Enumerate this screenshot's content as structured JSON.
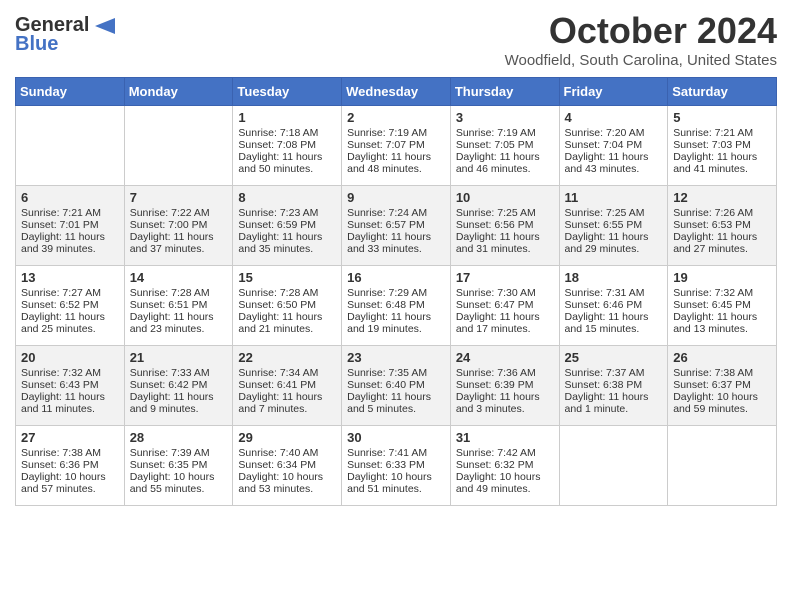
{
  "logo": {
    "line1": "General",
    "line2": "Blue",
    "icon": "▶"
  },
  "title": "October 2024",
  "location": "Woodfield, South Carolina, United States",
  "days_of_week": [
    "Sunday",
    "Monday",
    "Tuesday",
    "Wednesday",
    "Thursday",
    "Friday",
    "Saturday"
  ],
  "weeks": [
    [
      {
        "day": "",
        "content": ""
      },
      {
        "day": "",
        "content": ""
      },
      {
        "day": "1",
        "content": "Sunrise: 7:18 AM\nSunset: 7:08 PM\nDaylight: 11 hours and 50 minutes."
      },
      {
        "day": "2",
        "content": "Sunrise: 7:19 AM\nSunset: 7:07 PM\nDaylight: 11 hours and 48 minutes."
      },
      {
        "day": "3",
        "content": "Sunrise: 7:19 AM\nSunset: 7:05 PM\nDaylight: 11 hours and 46 minutes."
      },
      {
        "day": "4",
        "content": "Sunrise: 7:20 AM\nSunset: 7:04 PM\nDaylight: 11 hours and 43 minutes."
      },
      {
        "day": "5",
        "content": "Sunrise: 7:21 AM\nSunset: 7:03 PM\nDaylight: 11 hours and 41 minutes."
      }
    ],
    [
      {
        "day": "6",
        "content": "Sunrise: 7:21 AM\nSunset: 7:01 PM\nDaylight: 11 hours and 39 minutes."
      },
      {
        "day": "7",
        "content": "Sunrise: 7:22 AM\nSunset: 7:00 PM\nDaylight: 11 hours and 37 minutes."
      },
      {
        "day": "8",
        "content": "Sunrise: 7:23 AM\nSunset: 6:59 PM\nDaylight: 11 hours and 35 minutes."
      },
      {
        "day": "9",
        "content": "Sunrise: 7:24 AM\nSunset: 6:57 PM\nDaylight: 11 hours and 33 minutes."
      },
      {
        "day": "10",
        "content": "Sunrise: 7:25 AM\nSunset: 6:56 PM\nDaylight: 11 hours and 31 minutes."
      },
      {
        "day": "11",
        "content": "Sunrise: 7:25 AM\nSunset: 6:55 PM\nDaylight: 11 hours and 29 minutes."
      },
      {
        "day": "12",
        "content": "Sunrise: 7:26 AM\nSunset: 6:53 PM\nDaylight: 11 hours and 27 minutes."
      }
    ],
    [
      {
        "day": "13",
        "content": "Sunrise: 7:27 AM\nSunset: 6:52 PM\nDaylight: 11 hours and 25 minutes."
      },
      {
        "day": "14",
        "content": "Sunrise: 7:28 AM\nSunset: 6:51 PM\nDaylight: 11 hours and 23 minutes."
      },
      {
        "day": "15",
        "content": "Sunrise: 7:28 AM\nSunset: 6:50 PM\nDaylight: 11 hours and 21 minutes."
      },
      {
        "day": "16",
        "content": "Sunrise: 7:29 AM\nSunset: 6:48 PM\nDaylight: 11 hours and 19 minutes."
      },
      {
        "day": "17",
        "content": "Sunrise: 7:30 AM\nSunset: 6:47 PM\nDaylight: 11 hours and 17 minutes."
      },
      {
        "day": "18",
        "content": "Sunrise: 7:31 AM\nSunset: 6:46 PM\nDaylight: 11 hours and 15 minutes."
      },
      {
        "day": "19",
        "content": "Sunrise: 7:32 AM\nSunset: 6:45 PM\nDaylight: 11 hours and 13 minutes."
      }
    ],
    [
      {
        "day": "20",
        "content": "Sunrise: 7:32 AM\nSunset: 6:43 PM\nDaylight: 11 hours and 11 minutes."
      },
      {
        "day": "21",
        "content": "Sunrise: 7:33 AM\nSunset: 6:42 PM\nDaylight: 11 hours and 9 minutes."
      },
      {
        "day": "22",
        "content": "Sunrise: 7:34 AM\nSunset: 6:41 PM\nDaylight: 11 hours and 7 minutes."
      },
      {
        "day": "23",
        "content": "Sunrise: 7:35 AM\nSunset: 6:40 PM\nDaylight: 11 hours and 5 minutes."
      },
      {
        "day": "24",
        "content": "Sunrise: 7:36 AM\nSunset: 6:39 PM\nDaylight: 11 hours and 3 minutes."
      },
      {
        "day": "25",
        "content": "Sunrise: 7:37 AM\nSunset: 6:38 PM\nDaylight: 11 hours and 1 minute."
      },
      {
        "day": "26",
        "content": "Sunrise: 7:38 AM\nSunset: 6:37 PM\nDaylight: 10 hours and 59 minutes."
      }
    ],
    [
      {
        "day": "27",
        "content": "Sunrise: 7:38 AM\nSunset: 6:36 PM\nDaylight: 10 hours and 57 minutes."
      },
      {
        "day": "28",
        "content": "Sunrise: 7:39 AM\nSunset: 6:35 PM\nDaylight: 10 hours and 55 minutes."
      },
      {
        "day": "29",
        "content": "Sunrise: 7:40 AM\nSunset: 6:34 PM\nDaylight: 10 hours and 53 minutes."
      },
      {
        "day": "30",
        "content": "Sunrise: 7:41 AM\nSunset: 6:33 PM\nDaylight: 10 hours and 51 minutes."
      },
      {
        "day": "31",
        "content": "Sunrise: 7:42 AM\nSunset: 6:32 PM\nDaylight: 10 hours and 49 minutes."
      },
      {
        "day": "",
        "content": ""
      },
      {
        "day": "",
        "content": ""
      }
    ]
  ]
}
